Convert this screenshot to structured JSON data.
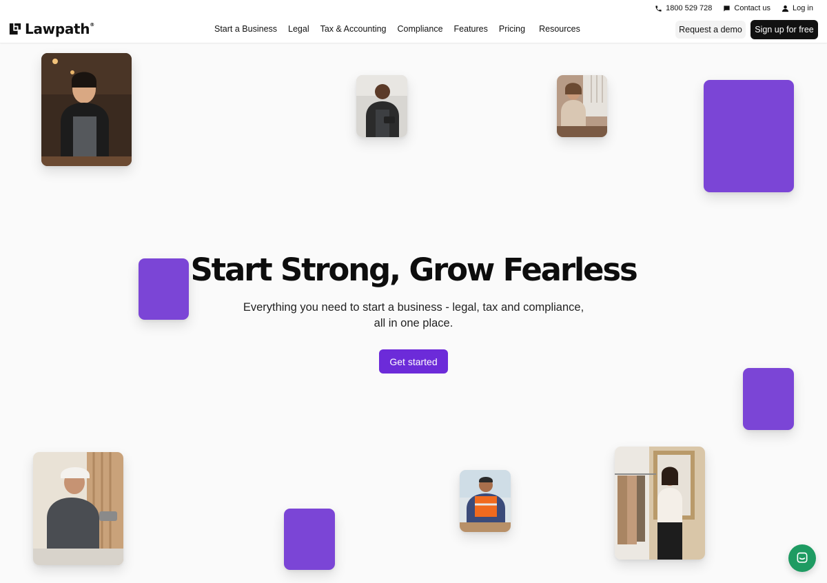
{
  "header": {
    "logo_text": "Lawpath",
    "logo_mark": "®",
    "utility": {
      "phone": "1800 529 728",
      "contact": "Contact us",
      "login": "Log in"
    },
    "nav": [
      "Start a Business",
      "Legal",
      "Tax & Accounting",
      "Compliance",
      "Features",
      "Pricing",
      "Resources"
    ],
    "request_demo": "Request a demo",
    "signup": "Sign up for free"
  },
  "hero": {
    "title": "Start Strong, Grow Fearless",
    "subtitle_line1": "Everything you need to start a business - legal, tax and compliance,",
    "subtitle_line2": "all in one place.",
    "cta": "Get started"
  },
  "colors": {
    "accent": "#6c2bd9",
    "tile_purple": "#7b45d6",
    "chat_green": "#1e9b62",
    "dark_button": "#111111"
  },
  "icons": {
    "phone": "phone-icon",
    "contact": "chat-icon",
    "login": "user-icon",
    "chat": "chat-bubble-icon"
  }
}
